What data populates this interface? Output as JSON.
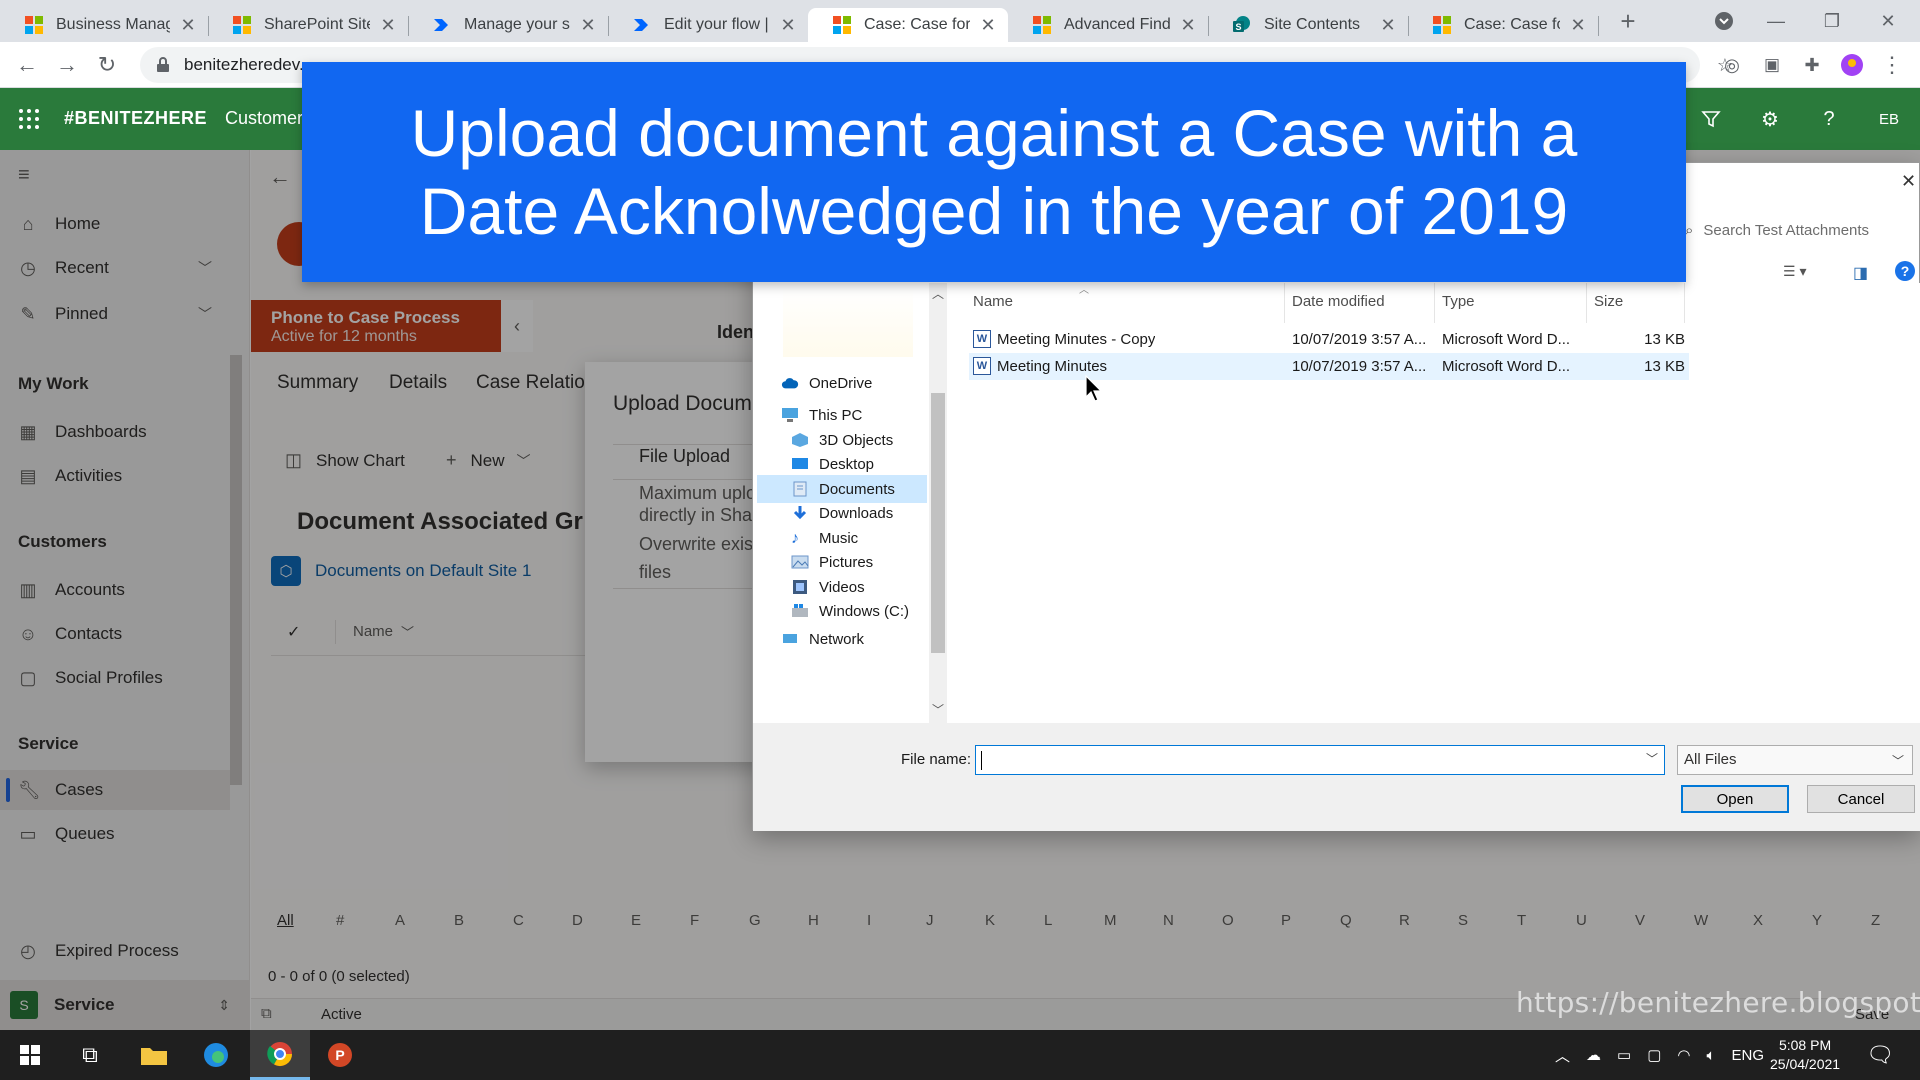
{
  "browser": {
    "tabs": [
      {
        "label": "Business Manage",
        "icon": "ms-logo-icon",
        "active": false
      },
      {
        "label": "SharePoint Site: In",
        "icon": "ms-logo-icon",
        "active": false
      },
      {
        "label": "Manage your solu",
        "icon": "power-automate-icon",
        "active": false
      },
      {
        "label": "Edit your flow | Po",
        "icon": "power-automate-icon",
        "active": false
      },
      {
        "label": "Case: Case for Int",
        "icon": "ms-logo-icon",
        "active": true
      },
      {
        "label": "Advanced Find - N",
        "icon": "ms-logo-icon",
        "active": false
      },
      {
        "label": "Site Contents",
        "icon": "sharepoint-icon",
        "active": false
      },
      {
        "label": "Case: Case for Int",
        "icon": "ms-logo-icon",
        "active": false
      }
    ],
    "url": "benitezheredev."
  },
  "app": {
    "brand": "#BENITEZHERE",
    "name": "Customer",
    "user_initials": "EB"
  },
  "sitemap": {
    "top": [
      {
        "label": "Home",
        "icon": "home-icon"
      },
      {
        "label": "Recent",
        "icon": "clock-icon"
      },
      {
        "label": "Pinned",
        "icon": "pin-icon"
      }
    ],
    "groups": [
      {
        "title": "My Work",
        "items": [
          {
            "label": "Dashboards",
            "icon": "dashboard-icon"
          },
          {
            "label": "Activities",
            "icon": "activities-icon"
          }
        ]
      },
      {
        "title": "Customers",
        "items": [
          {
            "label": "Accounts",
            "icon": "accounts-icon"
          },
          {
            "label": "Contacts",
            "icon": "contact-icon"
          },
          {
            "label": "Social Profiles",
            "icon": "social-icon"
          }
        ]
      },
      {
        "title": "Service",
        "items": [
          {
            "label": "Cases",
            "icon": "cases-icon"
          },
          {
            "label": "Queues",
            "icon": "queues-icon"
          }
        ]
      }
    ],
    "expired": "Expired Process",
    "area": {
      "letter": "S",
      "label": "Service"
    }
  },
  "record": {
    "bpf_title": "Phone to Case Process",
    "bpf_sub": "Active for 12 months",
    "header_field": "Iden",
    "tabs": [
      "Summary",
      "Details",
      "Case Relatio"
    ],
    "commands": {
      "show_chart": "Show Chart",
      "new": "New"
    },
    "doc_title": "Document Associated Gr",
    "doc_location": "Documents on Default Site 1",
    "grid_name_col": "Name",
    "jumpbar": [
      "All",
      "#",
      "A",
      "B",
      "C",
      "D",
      "E",
      "F",
      "G",
      "H",
      "I",
      "J",
      "K",
      "L",
      "M",
      "N",
      "O",
      "P",
      "Q",
      "R",
      "S",
      "T",
      "U",
      "V",
      "W",
      "X",
      "Y",
      "Z"
    ],
    "record_count": "0 - 0 of 0 (0 selected)",
    "status": "Active",
    "save": "Save"
  },
  "upload_dialog": {
    "title": "Upload Docume",
    "field": "File Upload",
    "hint": "Maximum uplo directly in Shar",
    "overwrite": "Overwrite exist files"
  },
  "file_dialog": {
    "search_placeholder": "Search Test Attachments",
    "nav": {
      "onedrive": "OneDrive",
      "thispc": "This PC",
      "items": [
        "3D Objects",
        "Desktop",
        "Documents",
        "Downloads",
        "Music",
        "Pictures",
        "Videos",
        "Windows (C:)"
      ],
      "network": "Network"
    },
    "columns": {
      "name": "Name",
      "date": "Date modified",
      "type": "Type",
      "size": "Size"
    },
    "files": [
      {
        "name": "Meeting Minutes - Copy",
        "date": "10/07/2019 3:57 A...",
        "type": "Microsoft Word D...",
        "size": "13 KB"
      },
      {
        "name": "Meeting Minutes",
        "date": "10/07/2019 3:57 A...",
        "type": "Microsoft Word D...",
        "size": "13 KB"
      }
    ],
    "filename_label": "File name:",
    "filename_value": "",
    "filter": "All Files",
    "open": "Open",
    "cancel": "Cancel"
  },
  "banner": {
    "line1": "Upload document against a Case with a",
    "line2": "Date Acknolwedged in the year of 2019"
  },
  "watermark": "https://benitezhere.blogspot.com",
  "taskbar": {
    "lang": "ENG",
    "time": "5:08 PM",
    "date": "25/04/2021"
  },
  "colors": {
    "d365_green": "#2a7a3b",
    "bpf_orange": "#c43e1c",
    "banner_blue": "#1167f1",
    "selection": "#cce8ff"
  }
}
